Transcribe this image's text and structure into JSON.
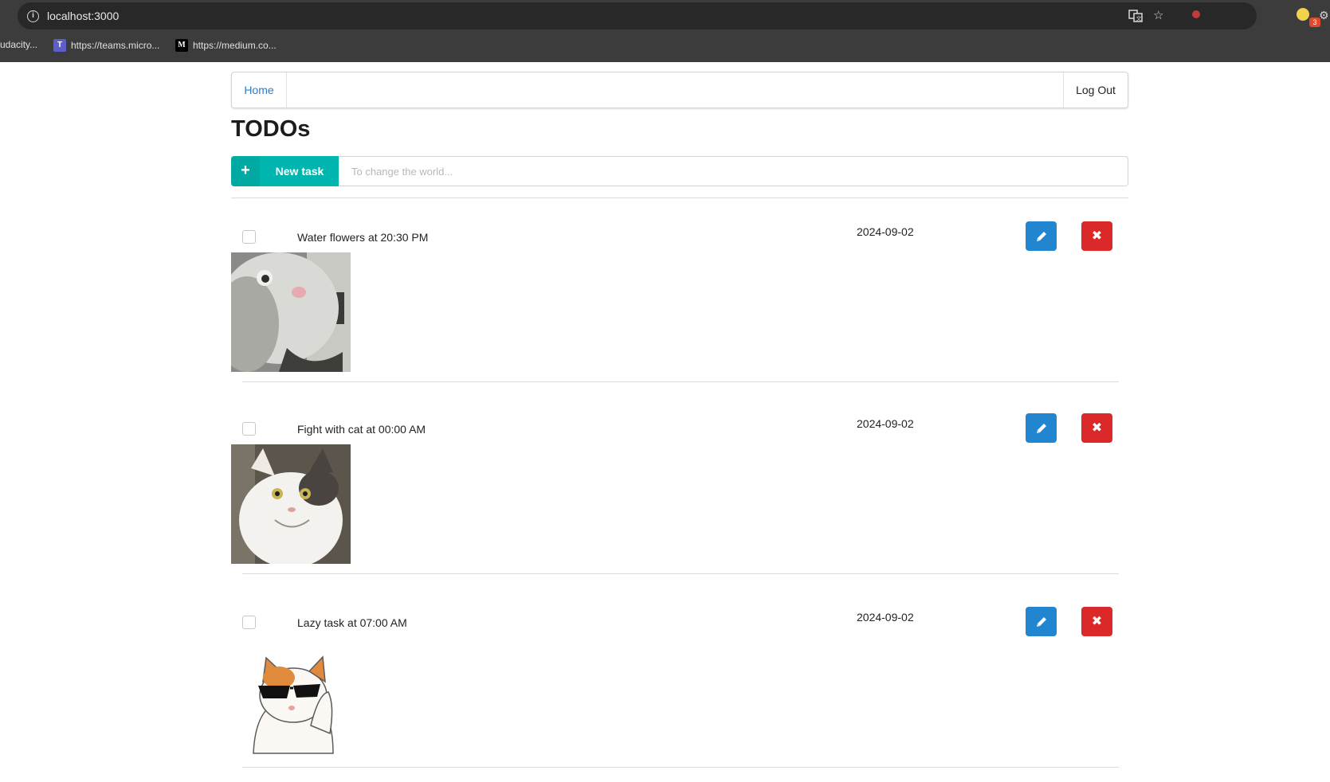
{
  "browser": {
    "url": "localhost:3000",
    "bookmarks": [
      {
        "label": "udacity...",
        "icon": "udacity-icon"
      },
      {
        "label": "https://teams.micro...",
        "icon": "teams-icon"
      },
      {
        "label": "https://medium.co...",
        "icon": "medium-icon",
        "icon_text": "M"
      }
    ],
    "extension_badge": "3"
  },
  "nav": {
    "home_label": "Home",
    "logout_label": "Log Out"
  },
  "page": {
    "title": "TODOs"
  },
  "new_task": {
    "button_label": "New task",
    "icon": "plus-icon",
    "input_placeholder": "To change the world...",
    "input_value": ""
  },
  "todos": [
    {
      "name": "Water flowers at 20:30 PM",
      "date": "2024-09-02",
      "done": false,
      "image": "cat-closeup-photo"
    },
    {
      "name": "Fight with cat at 00:00 AM",
      "date": "2024-09-02",
      "done": false,
      "image": "smiling-cat-photo"
    },
    {
      "name": "Lazy task at 07:00 AM",
      "date": "2024-09-02",
      "done": false,
      "image": "cool-cat-sunglasses-illustration"
    }
  ],
  "colors": {
    "new_task": "#00b5ad",
    "edit": "#2185d0",
    "delete": "#db2828",
    "link": "#2b7cc8",
    "chrome": "#3c3c3c"
  }
}
